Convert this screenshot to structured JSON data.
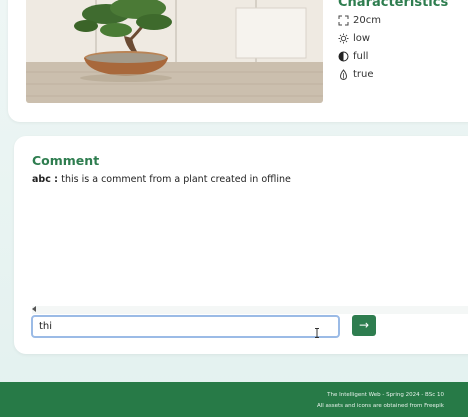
{
  "plant": {
    "image_alt": "bonsai tree in a pot",
    "characteristics_title": "Characteristics",
    "characteristics": [
      {
        "icon": "expand-icon",
        "value": "20cm"
      },
      {
        "icon": "sun-icon",
        "value": "low"
      },
      {
        "icon": "half-circle-icon",
        "value": "full"
      },
      {
        "icon": "seed-icon",
        "value": "true"
      }
    ]
  },
  "comments": {
    "title": "Comment",
    "items": [
      {
        "author": "abc",
        "separator": " : ",
        "text": "this is a comment from a plant created in offline"
      }
    ],
    "input_value": "thi",
    "send_label": "→"
  },
  "footer": {
    "line1": "The Intelligent Web - Spring 2024 - BSc 10",
    "line2": "All assets and icons are obtained from Freepik"
  },
  "colors": {
    "accent": "#2e7d4f",
    "footer_bg": "#277a47",
    "input_focus_border": "#9bbbe6"
  }
}
